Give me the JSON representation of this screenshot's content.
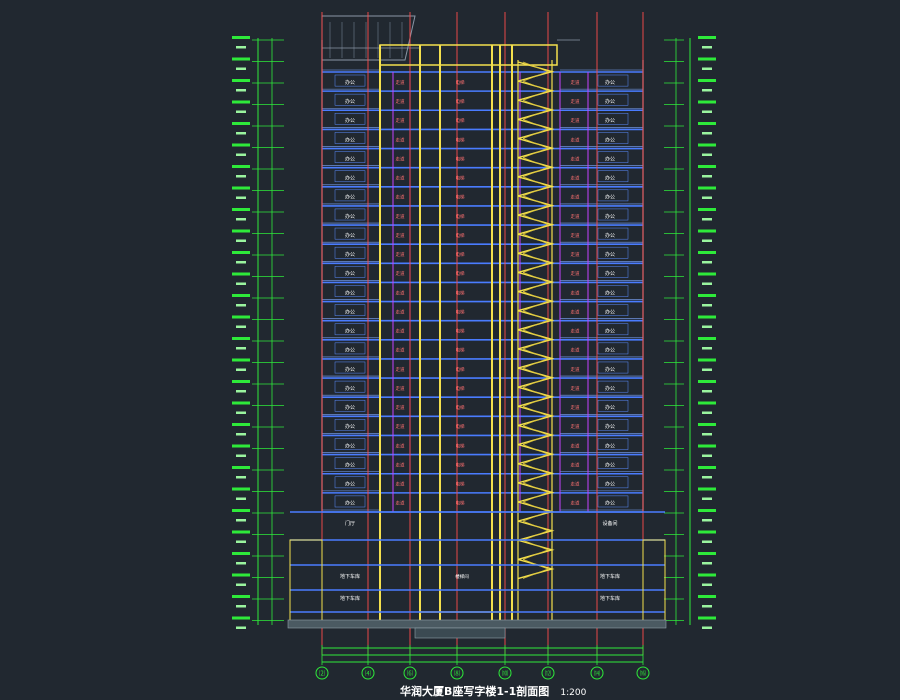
{
  "drawing": {
    "title": "华润大厦B座写字楼1-1剖面图",
    "scale": "1:200",
    "grid_axes": [
      "⑵",
      "⑷",
      "⑹",
      "⑻",
      "⑽",
      "⑿",
      "⒁",
      "⒃"
    ],
    "room_labels": {
      "office": "办公",
      "corridor": "走道",
      "stair": "楼梯间",
      "mech": "设备间",
      "parking": "地下车库",
      "lobby": "门厅",
      "elevator": "电梯"
    }
  },
  "colors": {
    "background": "#212830",
    "slab": "#4a7cff",
    "wall": "#f4e04d",
    "column": "#ff4b4b",
    "partition": "#c542ff",
    "dimension": "#2eea3a",
    "text": "#ffffff"
  },
  "stories": 23
}
